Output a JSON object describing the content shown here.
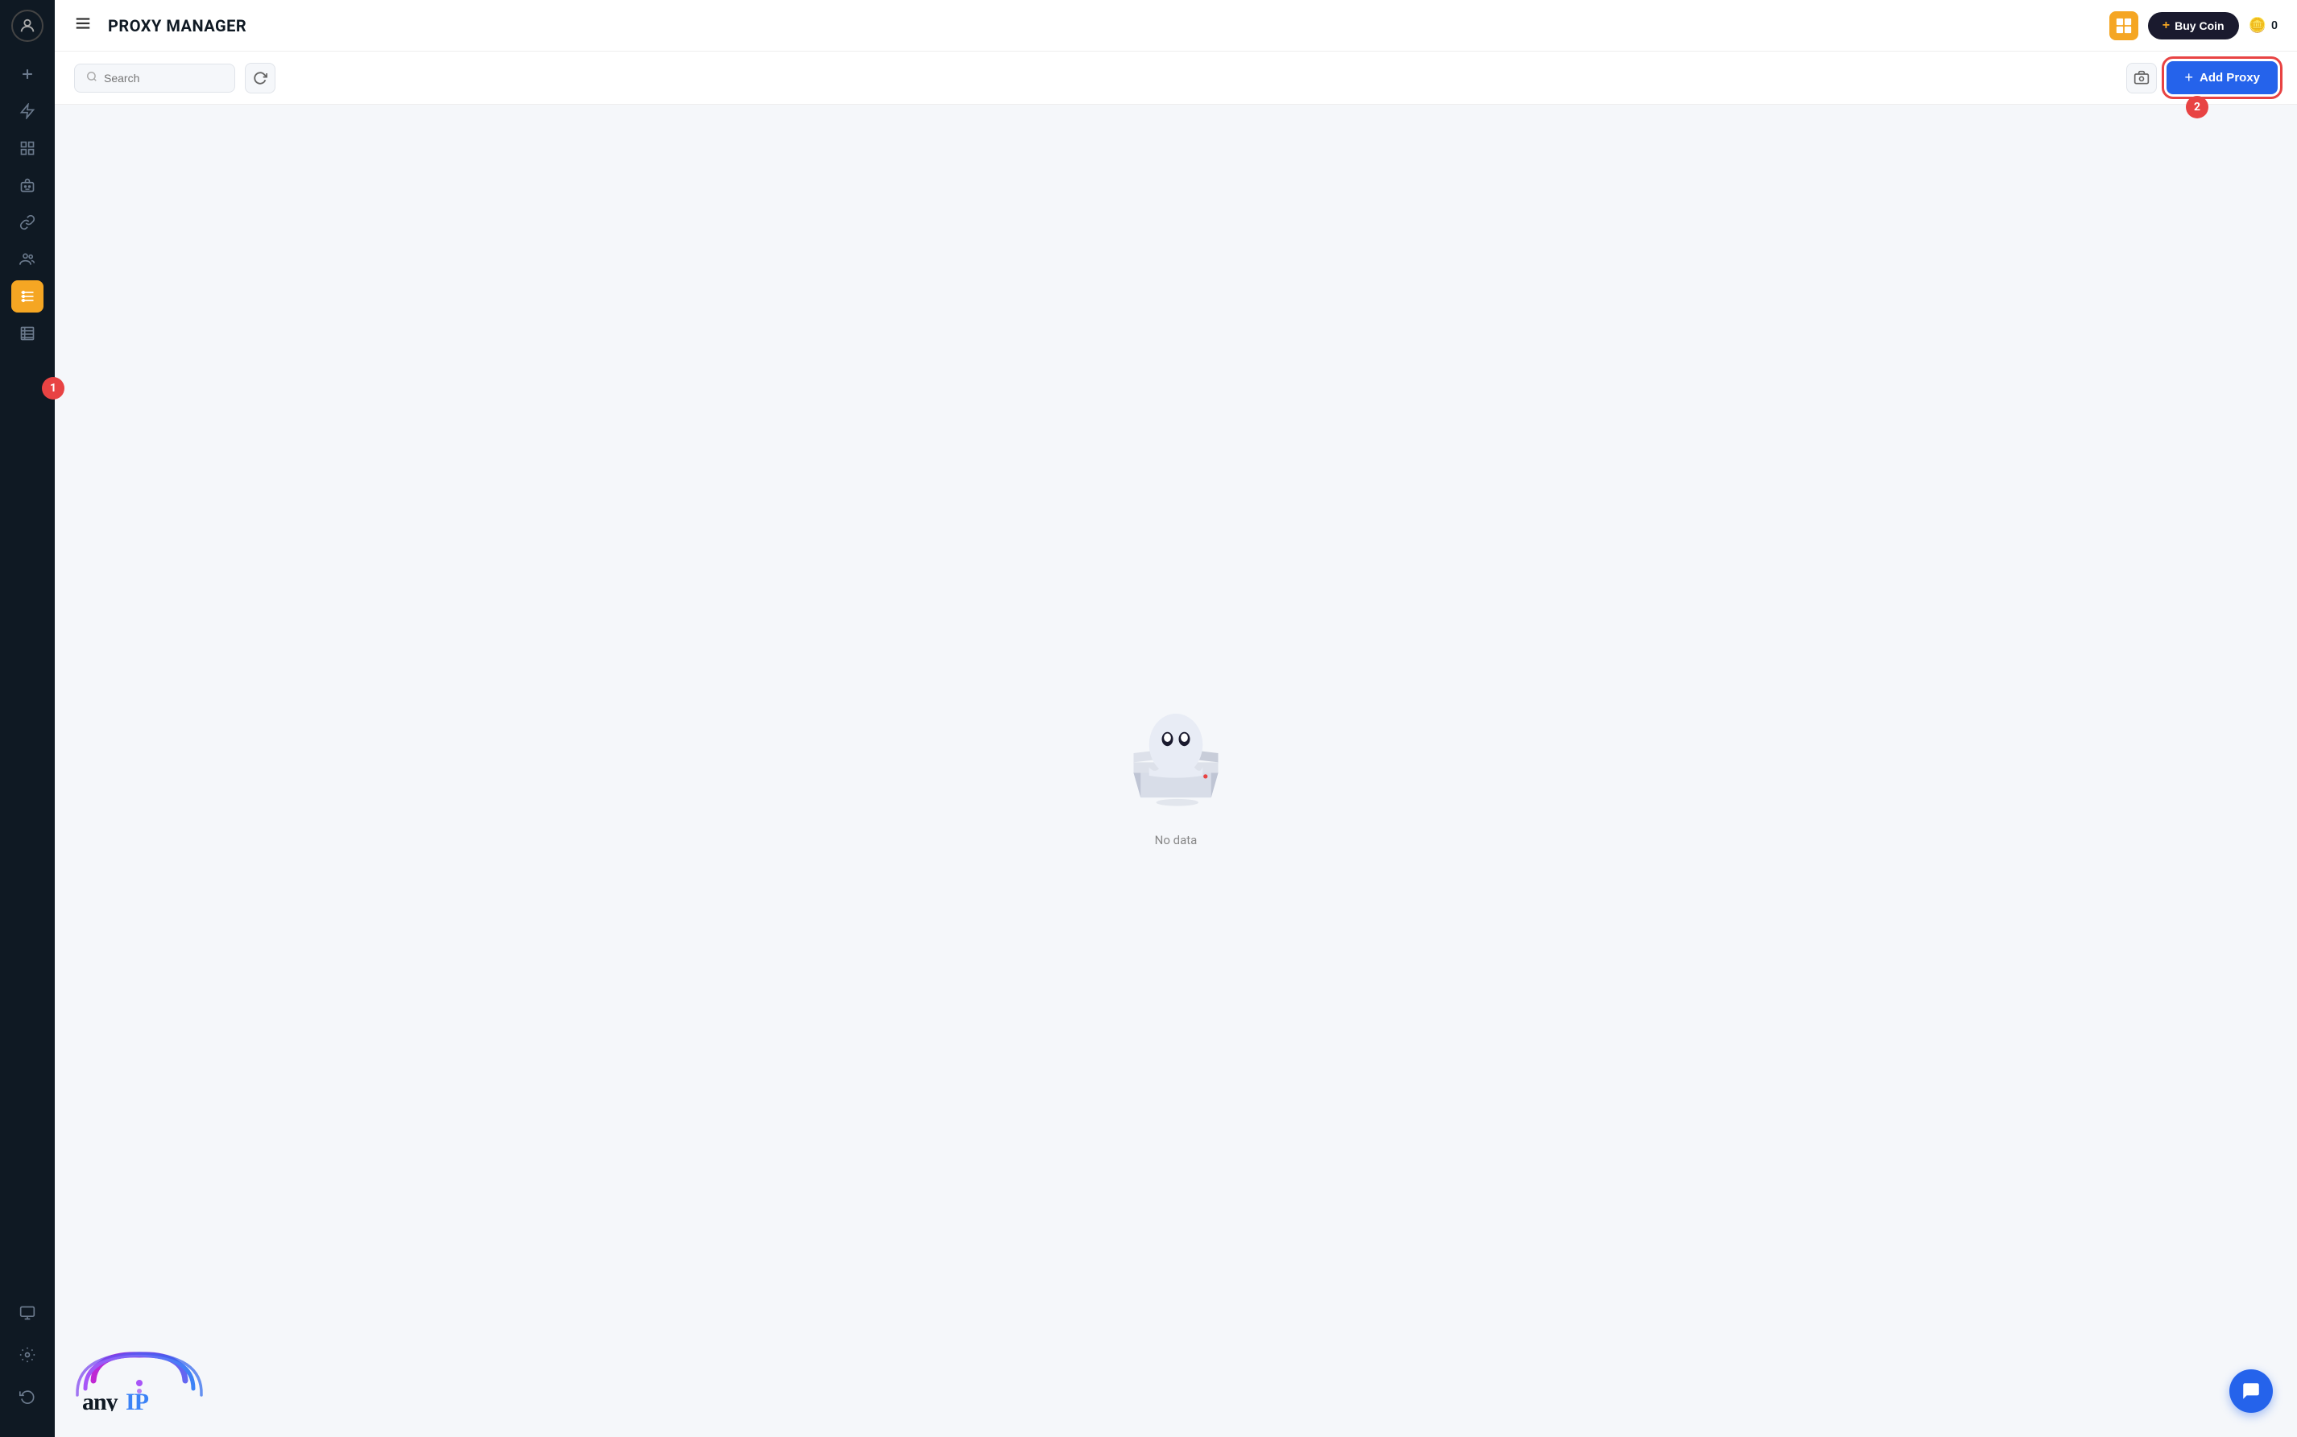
{
  "topbar": {
    "menu_icon": "☰",
    "title": "PROXY MANAGER",
    "buy_coin_label": "Buy Coin",
    "buy_coin_plus": "+",
    "coin_balance": "0",
    "coin_icon": "🪙"
  },
  "toolbar": {
    "search_placeholder": "Search",
    "refresh_icon": "↻",
    "screenshot_icon": "📷",
    "add_proxy_label": "Add Proxy",
    "add_proxy_plus": "+"
  },
  "empty_state": {
    "no_data_text": "No data"
  },
  "sidebar": {
    "items": [
      {
        "id": "add",
        "icon": "+",
        "active": false
      },
      {
        "id": "lightning",
        "icon": "⚡",
        "active": false
      },
      {
        "id": "grid",
        "icon": "⊞",
        "active": false
      },
      {
        "id": "robot",
        "icon": "🤖",
        "active": false
      },
      {
        "id": "link",
        "icon": "🔗",
        "active": false
      },
      {
        "id": "users",
        "icon": "👥",
        "active": false
      },
      {
        "id": "proxy-manager",
        "icon": "☰",
        "active": true
      },
      {
        "id": "data-table",
        "icon": "📋",
        "active": false
      }
    ],
    "bottom_items": [
      {
        "id": "device",
        "icon": "🖥"
      },
      {
        "id": "settings",
        "icon": "⚙"
      },
      {
        "id": "refresh",
        "icon": "↺"
      }
    ]
  },
  "step_badges": {
    "badge1": "1",
    "badge2": "2"
  },
  "chat": {
    "icon": "💬"
  },
  "logo": {
    "text": "anyIP"
  }
}
